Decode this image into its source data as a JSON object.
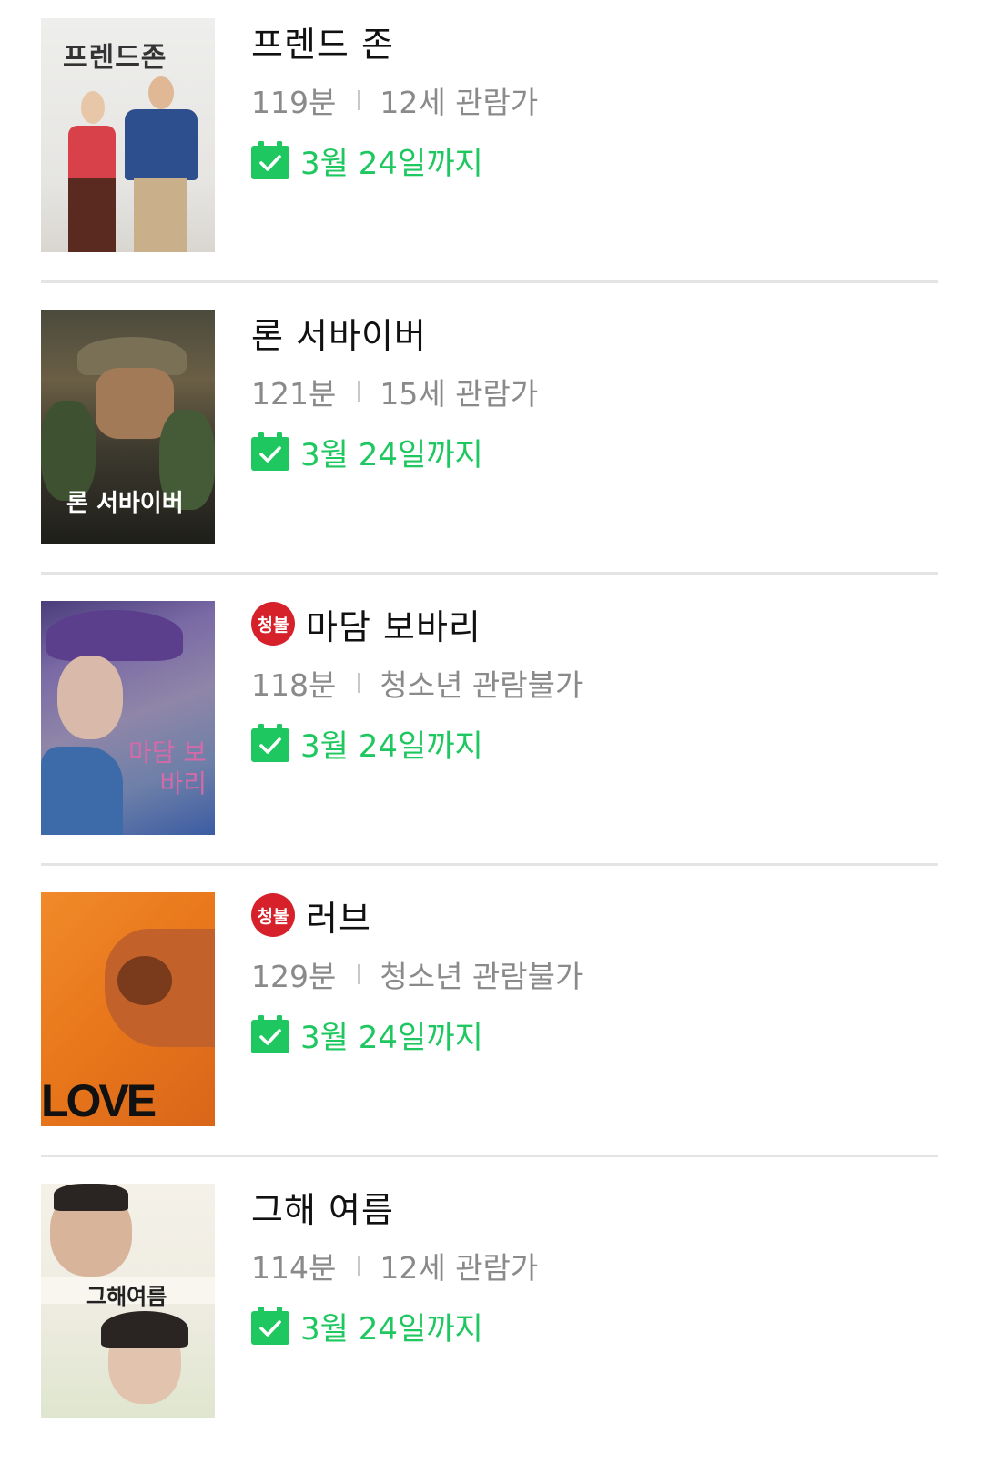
{
  "colors": {
    "accent_green": "#1ec75f",
    "restricted_red": "#d6202a",
    "meta_gray": "#8a8a8a",
    "divider": "#e4e4e4"
  },
  "icons": {
    "date": "calendar-check-icon",
    "restricted": "restricted-rating-badge"
  },
  "movies": [
    {
      "title": "프렌드 존",
      "runtime": "119분",
      "rating": "12세 관람가",
      "restricted_badge": "",
      "until": "3월 24일까지",
      "poster_text": "프렌드존"
    },
    {
      "title": "론 서바이버",
      "runtime": "121분",
      "rating": "15세 관람가",
      "restricted_badge": "",
      "until": "3월 24일까지",
      "poster_text": "론 서바이버"
    },
    {
      "title": "마담 보바리",
      "runtime": "118분",
      "rating": "청소년 관람불가",
      "restricted_badge": "청불",
      "until": "3월 24일까지",
      "poster_text": "마담 보바리"
    },
    {
      "title": "러브",
      "runtime": "129분",
      "rating": "청소년 관람불가",
      "restricted_badge": "청불",
      "until": "3월 24일까지",
      "poster_text": "LOVE"
    },
    {
      "title": "그해 여름",
      "runtime": "114분",
      "rating": "12세 관람가",
      "restricted_badge": "",
      "until": "3월 24일까지",
      "poster_text": "그해여름"
    }
  ]
}
